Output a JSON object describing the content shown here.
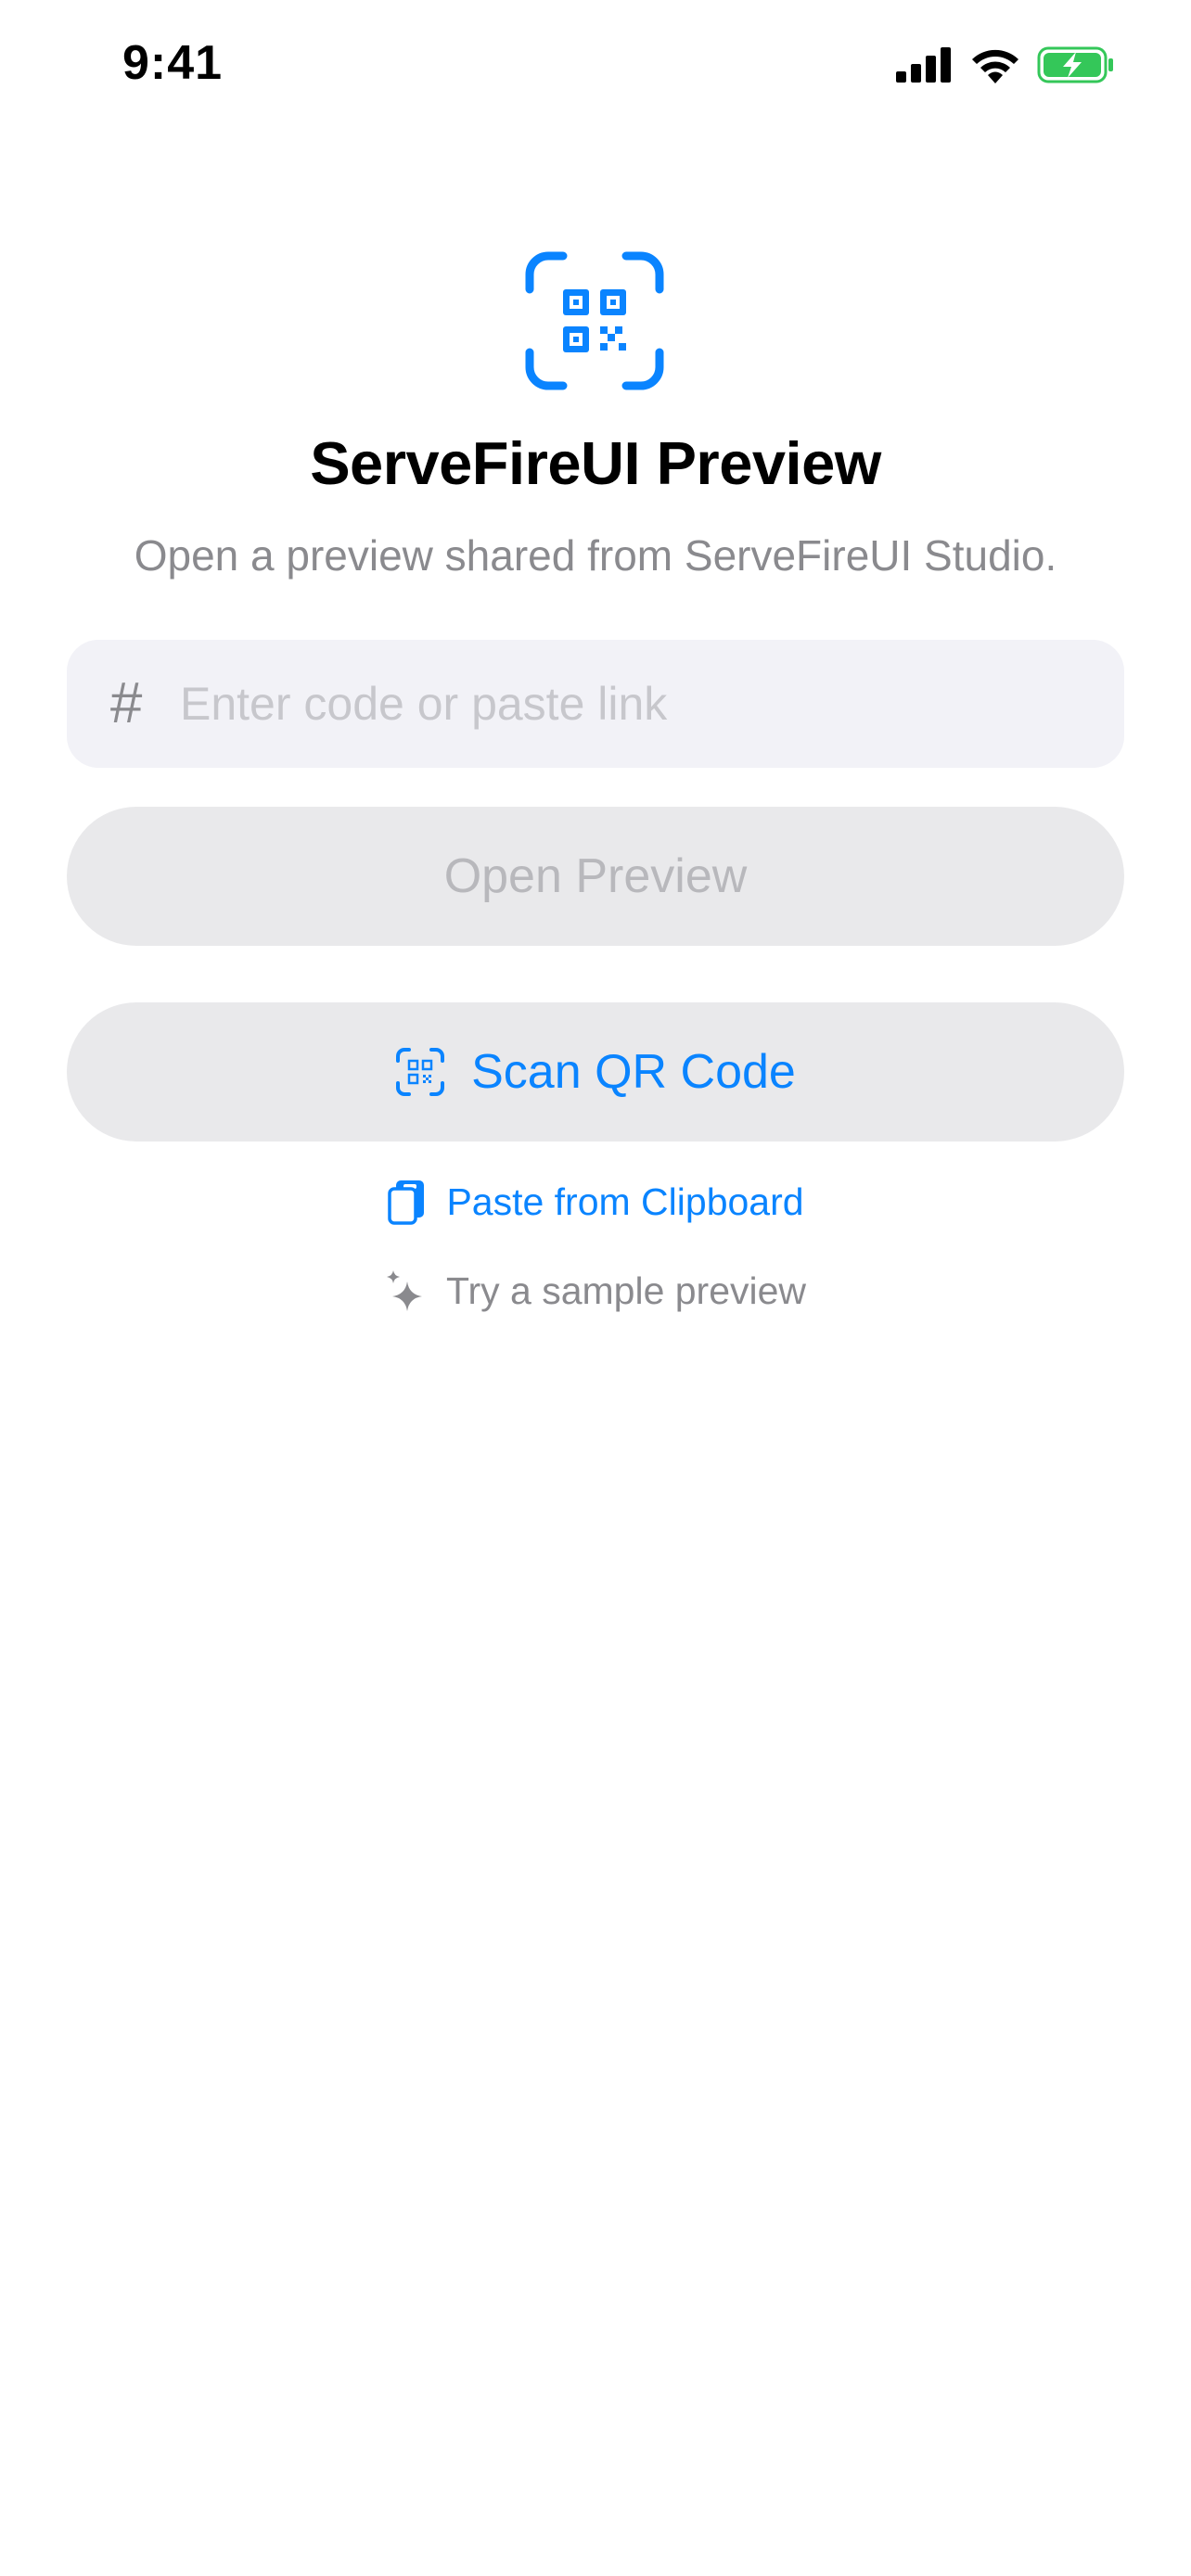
{
  "status_bar": {
    "time": "9:41"
  },
  "header": {
    "title": "ServeFireUI Preview",
    "subtitle": "Open a preview shared from ServeFireUI Studio."
  },
  "code_input": {
    "prefix_symbol": "#",
    "placeholder": "Enter code or paste link",
    "value": ""
  },
  "actions": {
    "open_preview_label": "Open Preview",
    "scan_qr_label": "Scan QR Code",
    "paste_label": "Paste from Clipboard",
    "sample_label": "Try a sample preview"
  },
  "icons": {
    "hero": "qr-scanner-icon",
    "scan_button": "qr-scanner-icon",
    "paste": "clipboard-icon",
    "sample": "sparkles-icon",
    "status": [
      "cellular-signal-icon",
      "wifi-icon",
      "battery-charging-icon"
    ]
  },
  "colors": {
    "accent": "#0a84ff",
    "secondary_text": "#8a8a8e",
    "placeholder": "#c7c7cc",
    "field_background": "#f2f2f7",
    "button_background": "#e9e9eb",
    "disabled_label": "#b8b8bc",
    "battery_fill": "#34c759"
  },
  "state": {
    "open_preview_enabled": false
  }
}
